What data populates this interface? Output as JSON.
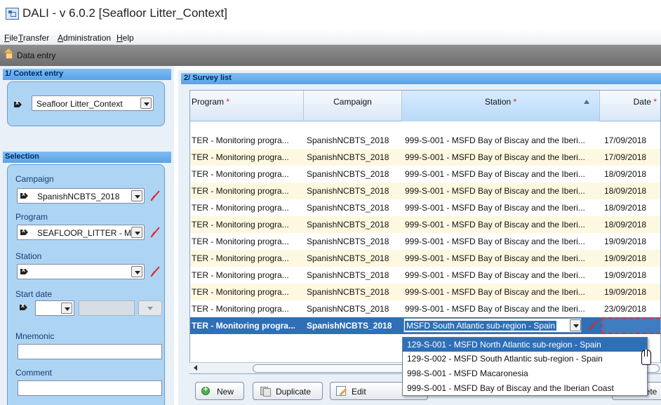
{
  "window": {
    "title": "DALI - v 6.0.2 [Seafloor Litter_Context]"
  },
  "menu": {
    "items": [
      "File",
      "Transfer",
      "Administration",
      "Help"
    ]
  },
  "screen": {
    "label": "Data entry"
  },
  "context": {
    "header": "1/ Context entry",
    "value": "Seafloor Litter_Context"
  },
  "selection": {
    "header": "Selection",
    "campaign_label": "Campaign",
    "campaign_value": "SpanishNCBTS_2018",
    "program_label": "Program",
    "program_value": "SEAFLOOR_LITTER - M",
    "station_label": "Station",
    "station_value": "",
    "start_date_label": "Start date",
    "mnemonic_label": "Mnemonic",
    "comment_label": "Comment"
  },
  "survey": {
    "header": "2/ Survey list",
    "columns": {
      "program": "Program",
      "campaign": "Campaign",
      "station": "Station",
      "date": "Date",
      "required_mark": "*"
    },
    "rows": [
      {
        "program": "TER - Monitoring progra...",
        "campaign": "SpanishNCBTS_2018",
        "station": "999-S-001 - MSFD Bay of Biscay and the Iberi...",
        "date": "17/09/2018"
      },
      {
        "program": "TER - Monitoring progra...",
        "campaign": "SpanishNCBTS_2018",
        "station": "999-S-001 - MSFD Bay of Biscay and the Iberi...",
        "date": "17/09/2018"
      },
      {
        "program": "TER - Monitoring progra...",
        "campaign": "SpanishNCBTS_2018",
        "station": "999-S-001 - MSFD Bay of Biscay and the Iberi...",
        "date": "18/09/2018"
      },
      {
        "program": "TER - Monitoring progra...",
        "campaign": "SpanishNCBTS_2018",
        "station": "999-S-001 - MSFD Bay of Biscay and the Iberi...",
        "date": "18/09/2018"
      },
      {
        "program": "TER - Monitoring progra...",
        "campaign": "SpanishNCBTS_2018",
        "station": "999-S-001 - MSFD Bay of Biscay and the Iberi...",
        "date": "18/09/2018"
      },
      {
        "program": "TER - Monitoring progra...",
        "campaign": "SpanishNCBTS_2018",
        "station": "999-S-001 - MSFD Bay of Biscay and the Iberi...",
        "date": "18/09/2018"
      },
      {
        "program": "TER - Monitoring progra...",
        "campaign": "SpanishNCBTS_2018",
        "station": "999-S-001 - MSFD Bay of Biscay and the Iberi...",
        "date": "19/09/2018"
      },
      {
        "program": "TER - Monitoring progra...",
        "campaign": "SpanishNCBTS_2018",
        "station": "999-S-001 - MSFD Bay of Biscay and the Iberi...",
        "date": "19/09/2018"
      },
      {
        "program": "TER - Monitoring progra...",
        "campaign": "SpanishNCBTS_2018",
        "station": "999-S-001 - MSFD Bay of Biscay and the Iberi...",
        "date": "19/09/2018"
      },
      {
        "program": "TER - Monitoring progra...",
        "campaign": "SpanishNCBTS_2018",
        "station": "999-S-001 - MSFD Bay of Biscay and the Iberi...",
        "date": "19/09/2018"
      },
      {
        "program": "TER - Monitoring progra...",
        "campaign": "SpanishNCBTS_2018",
        "station": "999-S-001 - MSFD Bay of Biscay and the Iberi...",
        "date": "23/09/2018"
      }
    ],
    "selected_row": {
      "program": "TER - Monitoring progra...",
      "campaign": "SpanishNCBTS_2018",
      "station_edit_value": "MSFD South Atlantic sub-region - Spain"
    },
    "station_options": [
      "129-S-001 - MSFD North Atlantic sub-region - Spain",
      "129-S-002 - MSFD South Atlantic sub-region - Spain",
      "998-S-001 - MSFD Macaronesia",
      "999-S-001 - MSFD Bay of Biscay and the Iberian Coast"
    ]
  },
  "toolbar": {
    "new_label": "New",
    "duplicate_label": "Duplicate",
    "edit_label": "Edit",
    "delete_label_partial": "lete"
  },
  "colors": {
    "panel_header": "#5aa3e6",
    "selection_blue": "#2f6fb6",
    "row_alt": "#fff8e0",
    "required": "#e02020",
    "clear_red": "#e3262b"
  }
}
